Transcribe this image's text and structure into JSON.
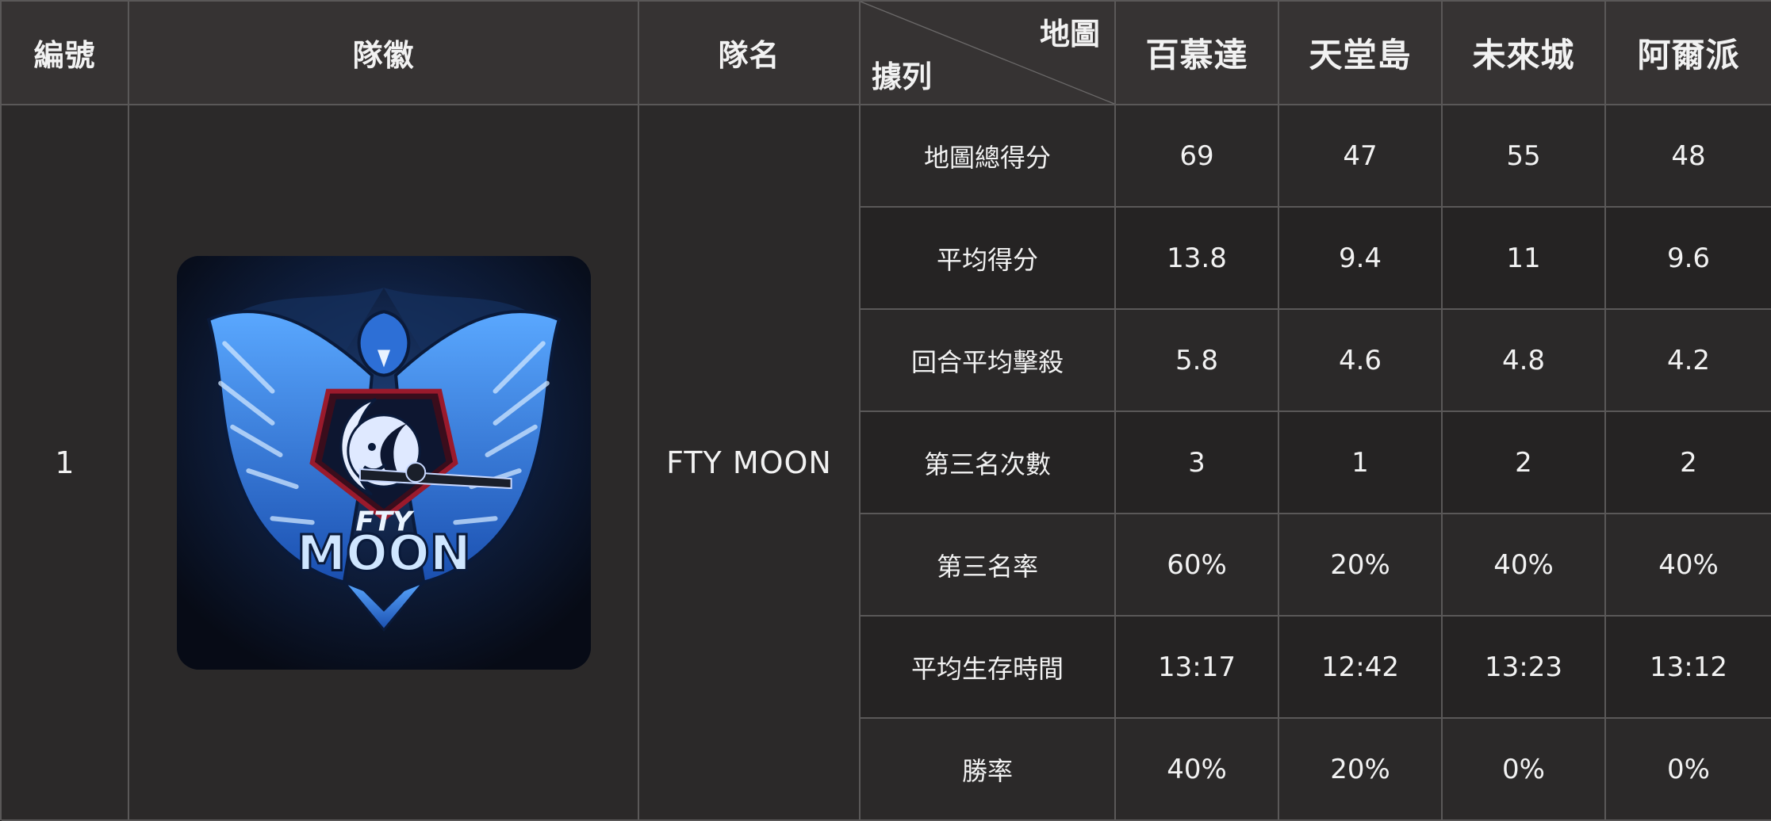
{
  "header": {
    "id_label": "編號",
    "logo_label": "隊徽",
    "name_label": "隊名",
    "diag_top": "地圖",
    "diag_bottom": "據列",
    "maps": [
      "百慕達",
      "天堂島",
      "未來城",
      "阿爾派"
    ]
  },
  "team": {
    "number": "1",
    "name": "FTY MOON",
    "logo_text_top": "FTY",
    "logo_text_bottom": "MOON"
  },
  "rows": [
    {
      "label": "地圖總得分",
      "values": [
        "69",
        "47",
        "55",
        "48"
      ]
    },
    {
      "label": "平均得分",
      "values": [
        "13.8",
        "9.4",
        "11",
        "9.6"
      ]
    },
    {
      "label": "回合平均擊殺",
      "values": [
        "5.8",
        "4.6",
        "4.8",
        "4.2"
      ]
    },
    {
      "label": "第三名次數",
      "values": [
        "3",
        "1",
        "2",
        "2"
      ]
    },
    {
      "label": "第三名率",
      "values": [
        "60%",
        "20%",
        "40%",
        "40%"
      ]
    },
    {
      "label": "平均生存時間",
      "values": [
        "13:17",
        "12:42",
        "13:23",
        "13:12"
      ]
    },
    {
      "label": "勝率",
      "values": [
        "40%",
        "20%",
        "0%",
        "0%"
      ]
    }
  ]
}
